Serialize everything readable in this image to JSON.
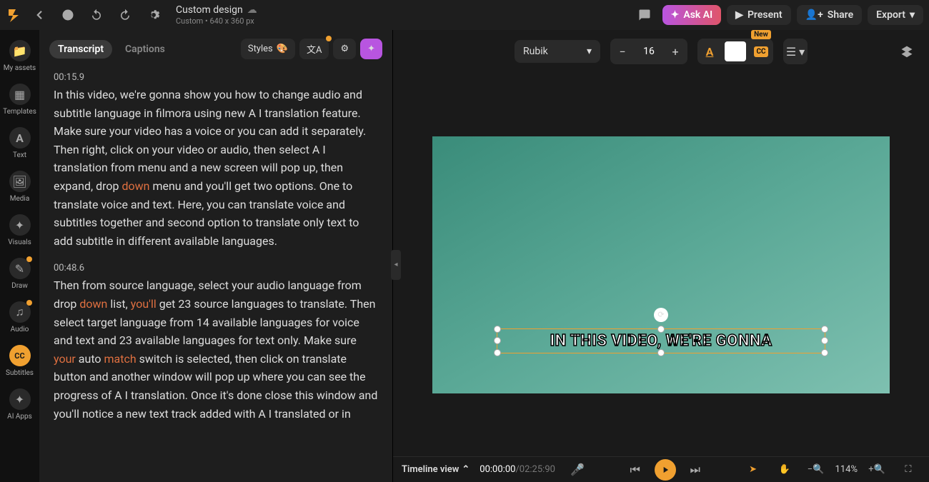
{
  "header": {
    "title": "Custom design",
    "subtitle": "Custom • 640 x 360 px",
    "ask_ai": "Ask AI",
    "present": "Present",
    "share": "Share",
    "export": "Export"
  },
  "leftnav": [
    {
      "label": "My assets"
    },
    {
      "label": "Templates"
    },
    {
      "label": "Text"
    },
    {
      "label": "Media"
    },
    {
      "label": "Visuals"
    },
    {
      "label": "Draw"
    },
    {
      "label": "Audio"
    },
    {
      "label": "Subtitles",
      "active": true
    },
    {
      "label": "AI Apps"
    }
  ],
  "panel": {
    "tab_transcript": "Transcript",
    "tab_captions": "Captions",
    "styles": "Styles"
  },
  "transcript": [
    {
      "time": "00:15.9",
      "parts": [
        {
          "t": "In this video, we're gonna show you how to change audio and subtitle language in filmora using new A I translation feature. Make sure your video has a voice or you can add it separately. Then right, click on your video or audio, then select A I translation from menu and a new screen will pop up, then expand, drop "
        },
        {
          "t": "down",
          "hl": true
        },
        {
          "t": " menu and you'll get two options. One to translate voice and text. Here, you can translate voice and subtitles together and second option to translate only text to add subtitle in different available languages."
        }
      ]
    },
    {
      "time": "00:48.6",
      "parts": [
        {
          "t": "Then from source language, select your audio language from drop "
        },
        {
          "t": "down",
          "hl": true
        },
        {
          "t": " list, "
        },
        {
          "t": "you'll",
          "hl": true
        },
        {
          "t": " get 23 source languages to translate. Then select target language from 14 available languages for voice and text and 23 available languages for text only. Make sure "
        },
        {
          "t": "your",
          "hl": true
        },
        {
          "t": " auto "
        },
        {
          "t": "match",
          "hl": true
        },
        {
          "t": " switch is selected, then click on translate button and another window will pop up where you can see the progress of A I translation. Once it's done close this window and you'll notice a new text track added with A I translated or in"
        }
      ]
    }
  ],
  "format": {
    "font": "Rubik",
    "size": "16",
    "cc_badge": "New"
  },
  "subtitle": "IN THIS VIDEO, WE'RE GONNA",
  "bottom": {
    "timeline_view": "Timeline view",
    "current": "00:00:00",
    "duration": "/02:25:90",
    "zoom": "114%"
  }
}
